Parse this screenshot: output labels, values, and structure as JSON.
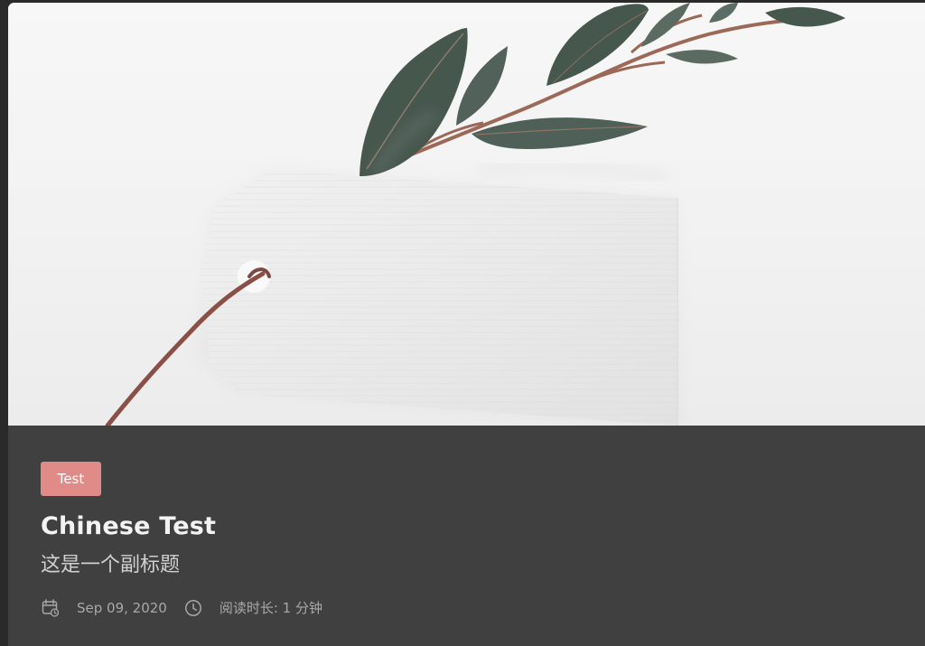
{
  "post": {
    "tag": "Test",
    "title": "Chinese Test",
    "subtitle": "这是一个副标题",
    "date": "Sep 09, 2020",
    "read_time": "阅读时长: 1 分钟"
  },
  "icons": {
    "calendar": "calendar-icon",
    "clock": "clock-icon"
  },
  "colors": {
    "page_background": "#2a2a2a",
    "card_background": "#404040",
    "tag_background": "#e08b88",
    "title": "#f3f3f3",
    "subtitle": "#d0d0d0",
    "meta": "#a8a8a8"
  }
}
